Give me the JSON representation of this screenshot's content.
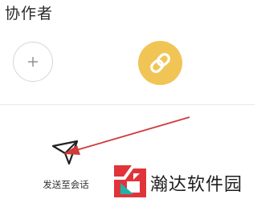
{
  "section": {
    "title": "协作者",
    "add_icon": "plus-icon",
    "link_icon": "link-icon",
    "link_color": "#f0c555"
  },
  "share": {
    "send_label": "发送至会话",
    "send_icon": "paper-plane-icon"
  },
  "annotation": {
    "arrow_color": "#d03a3a"
  },
  "watermark": {
    "text": "瀚达软件园",
    "logo_colors": [
      "#e0343a",
      "#1fb3a7"
    ]
  }
}
